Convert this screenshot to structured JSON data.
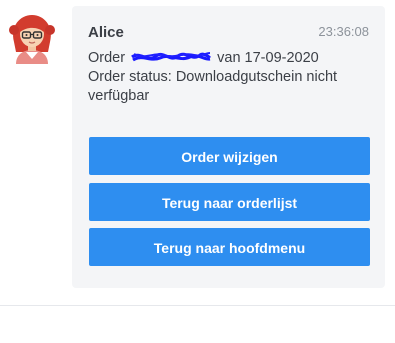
{
  "message": {
    "sender": "Alice",
    "time": "23:36:08",
    "order_prefix": "Order",
    "order_suffix": "van 17-09-2020",
    "status_line": "Order status: Downloadgutschein nicht verfügbar",
    "avatar_icon": "woman-avatar-icon",
    "redaction_icon": "scribble-redaction-icon"
  },
  "buttons": {
    "change_order": "Order wijzigen",
    "back_to_orders": "Terug naar orderlijst",
    "back_to_menu": "Terug naar hoofdmenu"
  },
  "colors": {
    "button": "#2e8ef0",
    "bubble": "#f4f5f7",
    "redaction": "#1a1aff"
  }
}
